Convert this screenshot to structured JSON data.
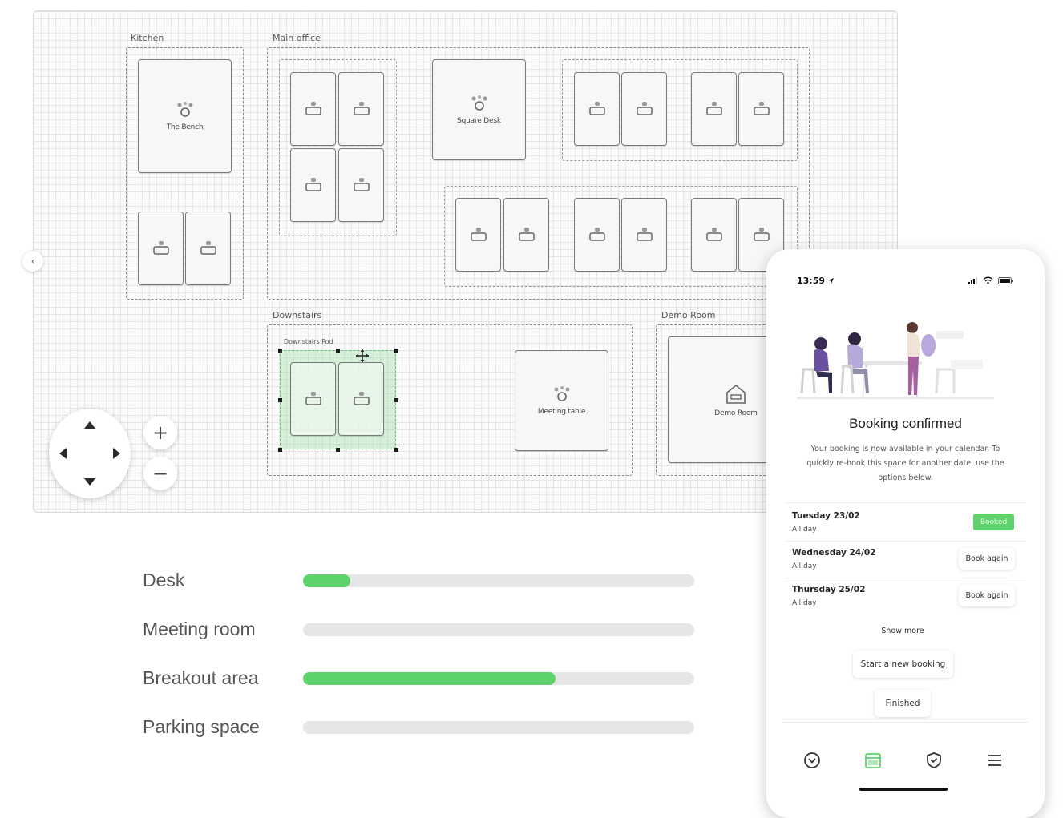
{
  "floor_plan": {
    "zones": {
      "kitchen": "Kitchen",
      "main_office": "Main office",
      "downstairs": "Downstairs",
      "downstairs_pod": "Downstairs Pod",
      "demo_room": "Demo Room"
    },
    "desks": {
      "the_bench": "The Bench",
      "square_desk": "Square Desk",
      "meeting_table": "Meeting table",
      "demo_room": "Demo Room"
    },
    "controls": {
      "zoom_in": "+",
      "zoom_out": "−",
      "collapse": "‹"
    }
  },
  "usage": [
    {
      "label": "Desk",
      "fill": 0.12
    },
    {
      "label": "Meeting room",
      "fill": 0
    },
    {
      "label": "Breakout area",
      "fill": 0.645
    },
    {
      "label": "Parking space",
      "fill": 0
    }
  ],
  "phone": {
    "status_time": "13:59",
    "title": "Booking confirmed",
    "message": "Your booking is now available in your calendar. To quickly re-book this space for another date, use the options below.",
    "bookings": [
      {
        "date": "Tuesday 23/02",
        "duration": "All day",
        "status": "Booked"
      },
      {
        "date": "Wednesday 24/02",
        "duration": "All day",
        "action": "Book again"
      },
      {
        "date": "Thursday 25/02",
        "duration": "All day",
        "action": "Book again"
      }
    ],
    "show_more": "Show more",
    "start_new": "Start a new booking",
    "finished": "Finished",
    "tabs": [
      "explore-icon",
      "calendar-icon",
      "shield-check-icon",
      "menu-icon"
    ],
    "accent": "#5fd36b"
  }
}
